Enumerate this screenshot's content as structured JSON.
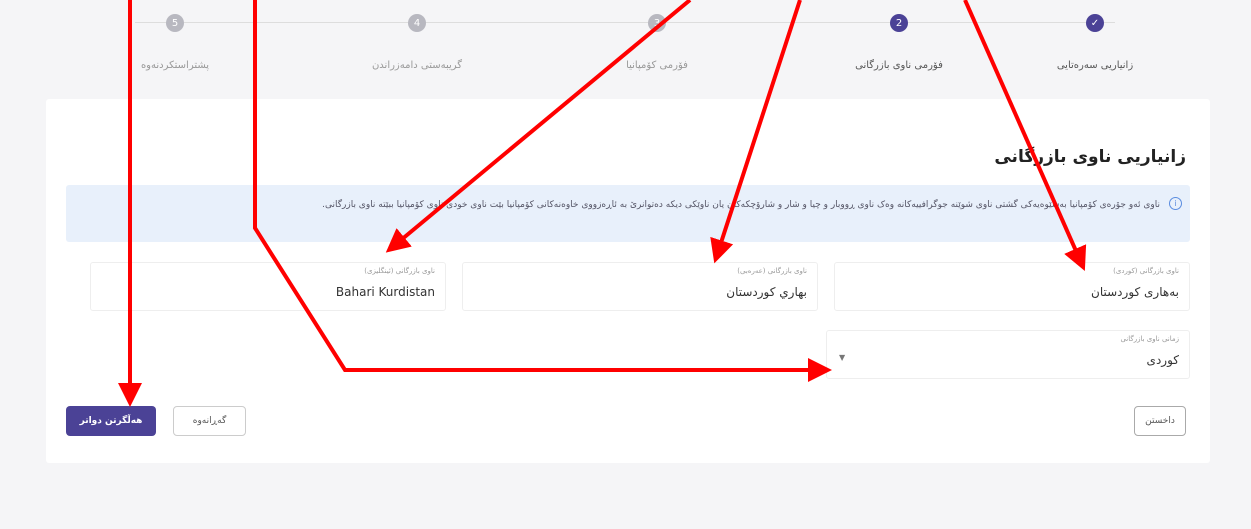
{
  "stepper": {
    "steps": [
      {
        "number": "",
        "label": "زانیاریی سەرەتایی",
        "state": "done"
      },
      {
        "number": "2",
        "label": "فۆرمی ناوی بازرگانی",
        "state": "active"
      },
      {
        "number": "3",
        "label": "فۆرمی کۆمپانیا",
        "state": "pending"
      },
      {
        "number": "4",
        "label": "گریبەستی دامەزراندن",
        "state": "pending"
      },
      {
        "number": "5",
        "label": "پشتراستکردنەوە",
        "state": "pending"
      }
    ]
  },
  "section": {
    "title": "زانیاریی ناوی بازرگانی"
  },
  "info": {
    "text": "ناوی ئەو جۆرەی کۆمپانیا بەشێوەیەکی گشتی ناوی شوێنە جوگرافییەکانە وەک ناوی ڕووبار و چیا و شار و شارۆچکەکان یان ناوێکی دیکە دەتوانرێ بە ئاڕەزووی خاوەنەکانی کۆمپانیا بێت ناوی خودی ناوی کۆمپانیا ببێتە ناوی بازرگانی."
  },
  "fields": {
    "kurdish": {
      "label": "ناوی بازرگانی (کوردی)",
      "value": "بەهاری کوردستان"
    },
    "arabic": {
      "label": "ناوی بازرگانی (عەرەبی)",
      "value": "بهاري كوردستان"
    },
    "english": {
      "label": "ناوی بازرگانی (ئینگلیزی)",
      "value": "Bahari Kurdistan"
    }
  },
  "select": {
    "label": "زمانی ناوی بازرگانی",
    "value": "کوردی"
  },
  "buttons": {
    "save_continue": "هەڵگرتن دواتر",
    "save": "گەڕانەوە",
    "back": "داخستن"
  },
  "colors": {
    "primary": "#4b4296",
    "annotation": "#ff0000",
    "info_bg": "#e8f0fb"
  }
}
